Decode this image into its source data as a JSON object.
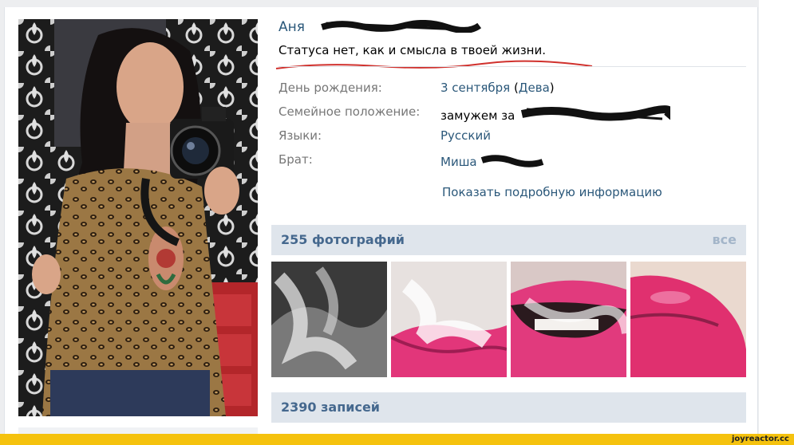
{
  "profile": {
    "first_name": "Аня",
    "status": "Статуса нет, как и смысла в твоей жизни."
  },
  "info": [
    {
      "label": "День рождения:",
      "value": "3 сентября",
      "suffix": "(Дева)"
    },
    {
      "label": "Семейное положение:",
      "value": "замужем за"
    },
    {
      "label": "Языки:",
      "value": "Русский"
    },
    {
      "label": "Брат:",
      "value": "Миша"
    }
  ],
  "show_more": "Показать подробную информацию",
  "photos": {
    "title": "255 фотографий",
    "all_link": "все"
  },
  "posts": {
    "title": "2390 записей"
  },
  "watermark": "joyreactor.cc",
  "colors": {
    "link": "#2b587a",
    "section_bg": "#dfe5ec",
    "section_title": "#45688e",
    "watermark_bg": "#f5c20e",
    "scribble": "#d0312d"
  }
}
